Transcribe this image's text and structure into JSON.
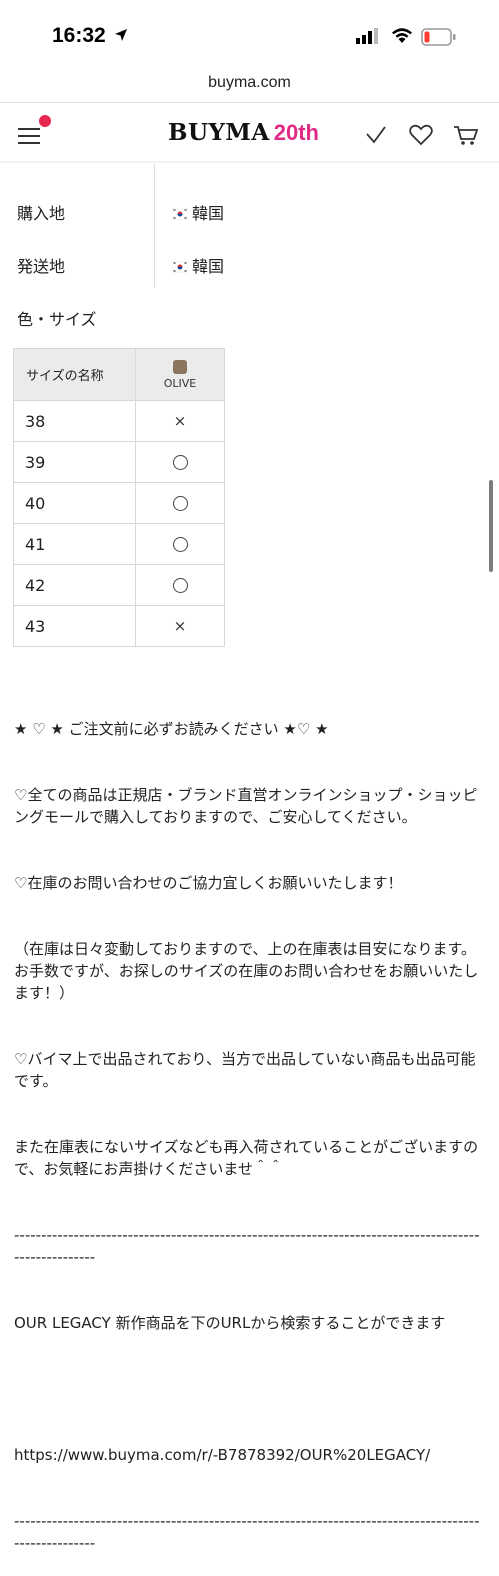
{
  "status_bar": {
    "time": "16:32"
  },
  "browser": {
    "url": "buyma.com"
  },
  "header": {
    "logo_word": "BUYMA",
    "logo_badge": "20th"
  },
  "specs": [
    {
      "label": "購入地",
      "value": "韓国"
    },
    {
      "label": "発送地",
      "value": "韓国"
    }
  ],
  "size_section": {
    "title": "色・サイズ",
    "size_header": "サイズの名称",
    "color_name": "OLIVE",
    "swatch_color": "#8a7560",
    "rows": [
      {
        "size": "38",
        "stock": "×"
      },
      {
        "size": "39",
        "stock": "○"
      },
      {
        "size": "40",
        "stock": "○"
      },
      {
        "size": "41",
        "stock": "○"
      },
      {
        "size": "42",
        "stock": "○"
      },
      {
        "size": "43",
        "stock": "×"
      }
    ]
  },
  "description": [
    "★ ♡ ★ ご注文前に必ずお読みください ★♡ ★",
    "♡全ての商品は正規店・ブランド直営オンラインショップ・ショッピングモールで購入しておりますので、ご安心してください。",
    "♡在庫のお問い合わせのご協力宜しくお願いいたします！",
    "（在庫は日々変動しておりますので、上の在庫表は目安になります。お手数ですが、お探しのサイズの在庫のお問い合わせをお願いいたします！）",
    "♡バイマ上で出品されており、当方で出品していない商品も出品可能です。",
    "また在庫表にないサイズなども再入荷されていることがございますので、お気軽にお声掛けくださいませ＾＾",
    "-----------------------------------------------------------------------------------------------------",
    "OUR LEGACY 新作商品を下のURLから検索することができます",
    "",
    "https://www.buyma.com/r/-B7878392/OUR%20LEGACY/",
    "-----------------------------------------------------------------------------------------------------"
  ]
}
